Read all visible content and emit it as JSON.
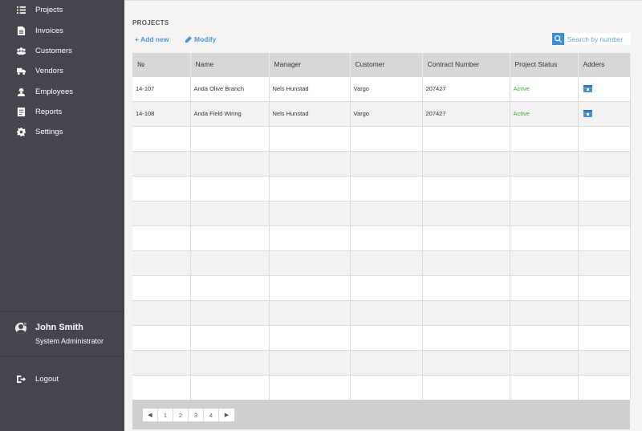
{
  "sidebar": {
    "items": [
      {
        "label": "Projects",
        "icon": "list-icon"
      },
      {
        "label": "Invoices",
        "icon": "document-icon"
      },
      {
        "label": "Customers",
        "icon": "users-icon"
      },
      {
        "label": "Vendors",
        "icon": "truck-icon"
      },
      {
        "label": "Employees",
        "icon": "worker-icon"
      },
      {
        "label": "Reports",
        "icon": "report-icon"
      },
      {
        "label": "Settings",
        "icon": "gear-icon"
      }
    ],
    "user": {
      "name": "John Smith",
      "role": "System Administrator"
    },
    "logout_label": "Logout"
  },
  "main": {
    "title": "PROJECTS",
    "add_label": "+ Add new",
    "modify_label": "Modify",
    "search": {
      "placeholder": "Search by number"
    }
  },
  "table": {
    "columns": [
      "№",
      "Name",
      "Manager",
      "Customer",
      "Contract Number",
      "Project Status",
      "Adders"
    ],
    "rows": [
      {
        "number": "14-107",
        "name": "Anda Olive Branch",
        "manager": "Nels Hunstad",
        "customer": "Vargo",
        "contract": "207427",
        "status": "Active"
      },
      {
        "number": "14-108",
        "name": "Anda Field Wiring",
        "manager": "Nels Hunstad",
        "customer": "Vargo",
        "contract": "207427",
        "status": "Active"
      }
    ],
    "empty_rows": 11
  },
  "pagination": {
    "prev_icon": "◀",
    "next_icon": "▶",
    "pages": [
      "1",
      "2",
      "3",
      "4"
    ]
  },
  "colors": {
    "sidebar_bg": "#44454f",
    "accent": "#4f95d8",
    "status_active": "#4aa84a",
    "header_bg": "#d7d7d7"
  }
}
